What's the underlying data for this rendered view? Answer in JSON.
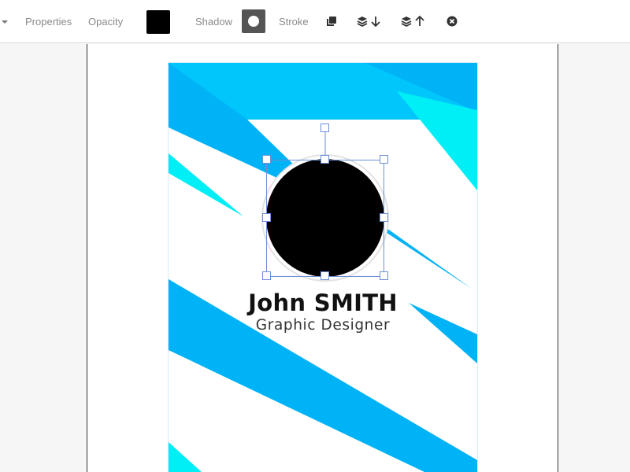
{
  "toolbar": {
    "properties_label": "Properties",
    "opacity_label": "Opacity",
    "shadow_label": "Shadow",
    "stroke_label": "Stroke",
    "swatch_color": "#000000",
    "icons": [
      "copy-icon",
      "send-backward-icon",
      "bring-forward-icon",
      "close-circle-icon"
    ]
  },
  "card": {
    "name": "John SMITH",
    "job_title": "Graphic Designer",
    "accent_colors": [
      "#00b4f7",
      "#00cdfa",
      "#00eef6"
    ],
    "avatar_color": "#000000"
  }
}
